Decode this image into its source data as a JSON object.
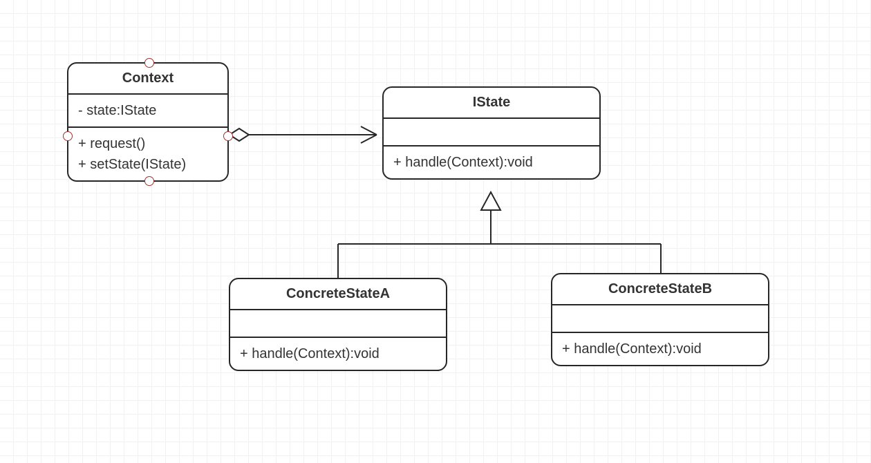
{
  "chart_data": {
    "type": "uml-class-diagram",
    "classes": [
      {
        "id": "Context",
        "name": "Context",
        "attributes": [
          "- state:IState"
        ],
        "operations": [
          "+ request()",
          "+ setState(IState)"
        ],
        "selected": true
      },
      {
        "id": "IState",
        "name": "IState",
        "attributes": [],
        "operations": [
          "+ handle(Context):void"
        ]
      },
      {
        "id": "ConcreteStateA",
        "name": "ConcreteStateA",
        "attributes": [],
        "operations": [
          "+ handle(Context):void"
        ]
      },
      {
        "id": "ConcreteStateB",
        "name": "ConcreteStateB",
        "attributes": [],
        "operations": [
          "+ handle(Context):void"
        ]
      }
    ],
    "relations": [
      {
        "from": "Context",
        "to": "IState",
        "type": "aggregation-to",
        "arrow": "open"
      },
      {
        "from": "ConcreteStateA",
        "to": "IState",
        "type": "generalization"
      },
      {
        "from": "ConcreteStateB",
        "to": "IState",
        "type": "generalization"
      }
    ]
  }
}
